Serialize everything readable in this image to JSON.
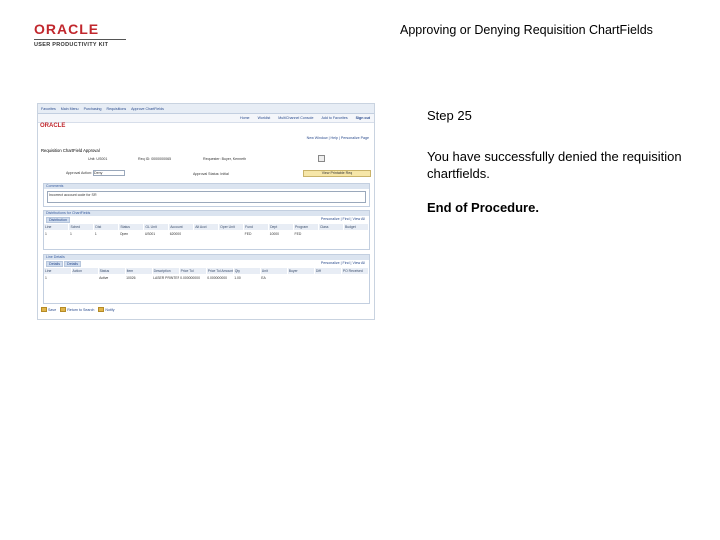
{
  "brand": {
    "line1": "ORACLE",
    "line2": "USER PRODUCTIVITY KIT"
  },
  "doc_title": "Approving or Denying Requisition ChartFields",
  "step": "Step 25",
  "description": "You have successfully denied the requisition chartfields.",
  "end_text": "End of Procedure.",
  "screenshot": {
    "breadcrumb": [
      "Favorites",
      "Main Menu",
      "Purchasing",
      "Requisitions",
      "Approve ChartFields"
    ],
    "topnav": [
      "Home",
      "Worklist",
      "MultiChannel Console",
      "Add to Favorites",
      "Sign out"
    ],
    "mini_logo": "ORACLE",
    "links": "New Window | Help | Personalize Page",
    "page_heading": "Requisition ChartField Approval",
    "fields": {
      "unit_label": "Unit:",
      "unit_value": "US001",
      "req_label": "Req ID:",
      "req_value": "0000000065",
      "requester_label": "Requester:",
      "requester_value": "Buyer, Kenneth",
      "action_label": "Approval Action:",
      "action_value": "Deny",
      "status_label": "Approval Status:",
      "status_value": "Initial",
      "view_button": "View Printable Req"
    },
    "comments": {
      "label": "Comments",
      "value": "Incorrect account code for SR"
    },
    "distribution": {
      "title": "Distributions for ChartFields",
      "subtab": "Distribution",
      "nav": "Personalize | Find | View All",
      "headers": [
        "Line",
        "Sched",
        "Dist",
        "Status",
        "GL Unit",
        "Account",
        "Alt Acct",
        "Oper Unit",
        "Fund",
        "Dept",
        "Program",
        "Class",
        "Budget"
      ],
      "row": [
        "1",
        "1",
        "1",
        "Open",
        "US001",
        "620000",
        "",
        "",
        "FED",
        "10000",
        "FED",
        "",
        ""
      ]
    },
    "lines": {
      "title": "Line Details",
      "subtabs": [
        "Details",
        "Details"
      ],
      "nav": "Personalize | Find | View All",
      "headers": [
        "Line",
        "Action",
        "Status",
        "Item",
        "Description",
        "Price Tol",
        "Price Tol Amount",
        "Qty",
        "Unit",
        "Buyer",
        "Diff",
        "PO Received"
      ],
      "row": [
        "1",
        "",
        "Active",
        "10026",
        "LASER PRINTER",
        "0.000000000",
        "0.000000000",
        "1.00",
        "EA",
        "",
        "",
        ""
      ]
    },
    "bottom_buttons": [
      "Save",
      "Return to Search",
      "Notify"
    ]
  }
}
